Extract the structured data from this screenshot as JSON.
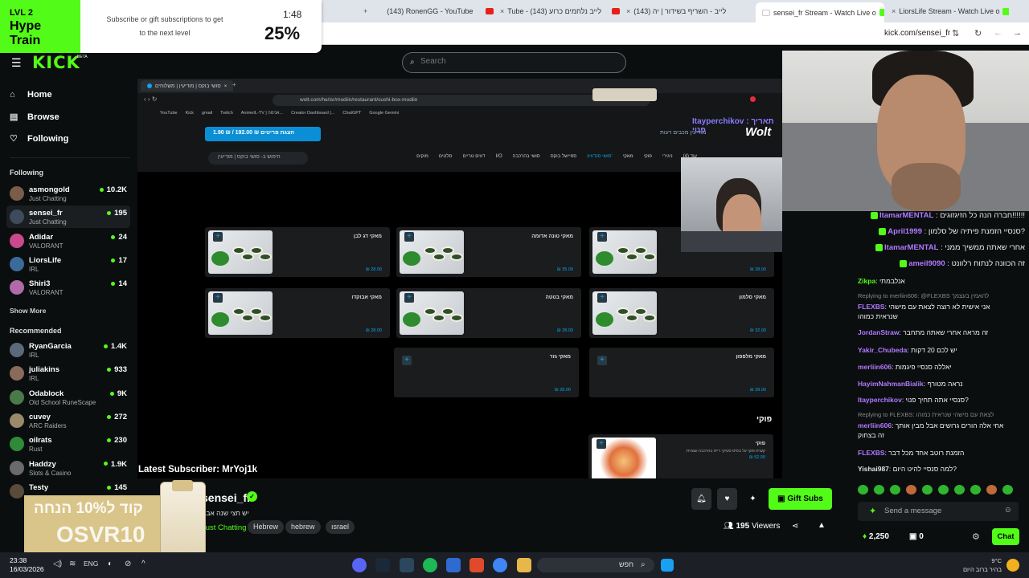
{
  "browser": {
    "tabs": [
      {
        "label": "(143) RonenGG - YouTube",
        "icon": "youtube-icon",
        "color": "#e62117"
      },
      {
        "label": "Tube - לייב נלחמים כרוע (143)",
        "icon": "youtube-icon",
        "color": "#e62117"
      },
      {
        "label": "לייב - השריף בשידור | יה (143)",
        "icon": "youtube-icon",
        "color": "#e62117"
      },
      {
        "label": "sensei_fr Stream - Watch Live o",
        "icon": "kick-icon",
        "color": "#53fc18"
      },
      {
        "label": "LiorsLife Stream - Watch Live o",
        "icon": "kick-icon",
        "color": "#53fc18"
      }
    ],
    "url": "kick.com/sensei_fr"
  },
  "hype_train": {
    "level": "LVL 2",
    "title": "Hype Train",
    "message": "Subscribe or gift subscriptions to get to the next level",
    "time": "1:48",
    "progress": "25%"
  },
  "header": {
    "logo": "KICK",
    "beta": "BETA",
    "search_placeholder": "Search"
  },
  "sidebar": {
    "nav": [
      {
        "label": "Home",
        "icon": "home-icon"
      },
      {
        "label": "Browse",
        "icon": "browse-icon"
      },
      {
        "label": "Following",
        "icon": "heart-icon"
      }
    ],
    "following_title": "Following",
    "following": [
      {
        "name": "asmongold",
        "category": "Just Chatting",
        "viewers": "10.2K",
        "color": "#7a5c4a"
      },
      {
        "name": "sensei_fr",
        "category": "Just Chatting",
        "viewers": "195",
        "color": "#3d4b5c"
      },
      {
        "name": "Adidar",
        "category": "VALORANT",
        "viewers": "24",
        "color": "#c94a8a"
      },
      {
        "name": "LiorsLife",
        "category": "IRL",
        "viewers": "17",
        "color": "#3a6b9a"
      },
      {
        "name": "Shiri3",
        "category": "VALORANT",
        "viewers": "14",
        "color": "#b06aa8"
      }
    ],
    "show_more": "Show More",
    "recommended_title": "Recommended",
    "recommended": [
      {
        "name": "RyanGarcia",
        "category": "IRL",
        "viewers": "1.4K",
        "color": "#5b6a7a"
      },
      {
        "name": "juliakins",
        "category": "IRL",
        "viewers": "933",
        "color": "#8a6a5a"
      },
      {
        "name": "Odablock",
        "category": "Old School RuneScape",
        "viewers": "9K",
        "color": "#4a7a4a"
      },
      {
        "name": "cuvey",
        "category": "ARC Raiders",
        "viewers": "272",
        "color": "#9a8a6a"
      },
      {
        "name": "oilrats",
        "category": "Rust",
        "viewers": "230",
        "color": "#2f8a3a"
      },
      {
        "name": "Haddzy",
        "category": "Slots & Casino",
        "viewers": "1.9K",
        "color": "#6a6a6a"
      },
      {
        "name": "Testy",
        "category": "",
        "viewers": "145",
        "color": "#5a4a3a"
      }
    ]
  },
  "stream": {
    "inner_tab": "סושי בוקס | מודיעין | משלוחים",
    "inner_url": "wolt.com/he/isr/modiin/restaurant/sushi-box-modiin",
    "bookmarks": [
      "YouTube",
      "Kick",
      "gmail",
      "Twitch",
      "AnimeIL-TV | אנימה...",
      "Creator Dashboard |...",
      "ChatGPT",
      "Google Gemini"
    ],
    "promo_box": "הצגת פריטים ₪ 192.00 / ₪ 1.90",
    "wolt_logo": "Wolt",
    "wolt_location": "מודיעין מכבים רעות",
    "wolt_search": "חיפוש ב- סושי בוקס | מודיעין",
    "wolt_categories": [
      "עוד (4)",
      "ניגירי",
      "פוקי",
      "מאקי",
      "סושי סנדוויץ'",
      "ספיישל בוקס",
      "סושי בהרכבה",
      "I/O",
      "דעים טריים",
      "סלטים",
      "מוקים"
    ],
    "wolt_selected_category": "סושי סנדוויץ'",
    "overlay_name": "Itayperchikov : תאריך פנוי",
    "menu_cards": [
      {
        "title": "מאקי סלמון",
        "price": "₪ 28.00",
        "img": true
      },
      {
        "title": "מאקי טונה אדומה",
        "price": "₪ 35.00",
        "img": true
      },
      {
        "title": "מאקי דג לבן",
        "price": "₪ 28.00",
        "img": true
      },
      {
        "title": "מאקי סלמון",
        "price": "₪ 32.00",
        "img": true
      },
      {
        "title": "מאקי בטטה",
        "price": "₪ 28.00",
        "img": true
      },
      {
        "title": "מאקי אבוקדו",
        "price": "₪ 28.00",
        "img": true
      },
      {
        "title": "מאקי מלפפון",
        "price": "₪ 28.00",
        "img": false
      },
      {
        "title": "מאקי גזר",
        "price": "₪ 28.00",
        "img": false
      }
    ],
    "poke_title": "פוקי",
    "poke_card": {
      "title": "פוקי",
      "desc": "קערת פוקי על בסיס סטיקי רייס בהרכבה עצמית",
      "price": "₪ 52.00"
    },
    "latest_subscriber": "Latest Subscriber: MrYoj1k"
  },
  "chat": {
    "overlay_lines": [
      {
        "user": "ItamarMENTAL",
        "text": "חברה הנה כל הזיגזוגים!!!!!!"
      },
      {
        "user": "April1999",
        "text": "סנסיי הזמנת פיתיה של סלמון?"
      },
      {
        "user": "ItamarMENTAL",
        "text": "אחרי שאתה ממשיך ממני"
      },
      {
        "user": "ameil9090",
        "text": "זה הכוונה לנתוח רלוונט"
      }
    ],
    "messages": [
      {
        "user": "Zikpa",
        "text": "אנלבמתי",
        "color": "#53fc18",
        "reply": ""
      },
      {
        "user": "FLEXBS",
        "text": "אני אישית לא רוצה לצאת עם מישהי שנראית כמוהו",
        "color": "#b07aff",
        "reply": "Replying to merliin606: @FLEXBS להאמין בעצמך"
      },
      {
        "user": "JordanStraw",
        "text": "זה מראה אחרי שאתה מתחבר",
        "color": "#b07aff",
        "reply": ""
      },
      {
        "user": "Yakir_Chubeda",
        "text": "יש לכם 20 דקות",
        "color": "#b07aff",
        "reply": ""
      },
      {
        "user": "merliin606",
        "text": "יאללה סנסיי פיגמות",
        "color": "#b07aff",
        "reply": ""
      },
      {
        "user": "HayimNahmanBialik",
        "text": "נראה מטורף",
        "color": "#b07aff",
        "reply": ""
      },
      {
        "user": "Itayperchikov",
        "text": "סנסיי אתה תחיך פנוי?",
        "color": "#b07aff",
        "reply": ""
      },
      {
        "user": "merliin606",
        "text": "אחי אלה הורים גרושים אבל מבין אותך זה בצחוק",
        "color": "#b07aff",
        "reply": "Replying to FLEXBS: לצאת עם מישהי שנראית כמוהו"
      },
      {
        "user": "FLEXBS",
        "text": "הזמנת רוטב אחד מכל דבר",
        "color": "#b07aff",
        "reply": ""
      },
      {
        "user": "Yishai987",
        "text": "למה סנסיי להיט היום?",
        "color": "#e0e0e0",
        "reply": ""
      }
    ],
    "input_placeholder": "Send a message",
    "points": "2,250",
    "chest": "0",
    "chat_button": "Chat"
  },
  "channel": {
    "name": "sensei_fr",
    "title": "יש חצי שנה אבא",
    "category": "Just Chatting",
    "tags": [
      "Hebrew",
      "hebrew",
      "ısrael"
    ],
    "viewers": "195",
    "viewers_label": "Viewers",
    "gift_label": "Gift Subs"
  },
  "promo_overlay": {
    "line1": "קוד ל10% הנחה",
    "line2": "OSVR10"
  },
  "taskbar": {
    "time": "23:38",
    "date": "16/03/2026",
    "lang": "ENG",
    "search": "חפש",
    "temp": "9°C",
    "weather": "בהיר ברוב היום"
  }
}
